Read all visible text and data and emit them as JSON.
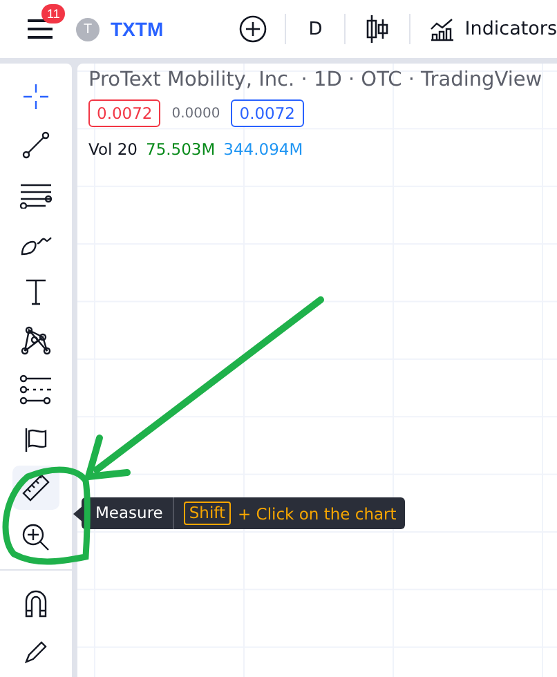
{
  "header": {
    "notification_count": "11",
    "symbol_initial": "T",
    "symbol": "TXTM",
    "interval": "D",
    "indicators_label": "Indicators"
  },
  "legend": {
    "title": "ProText Mobility, Inc. · 1D · OTC · TradingView",
    "sell_price": "0.0072",
    "spread": "0.0000",
    "buy_price": "0.0072",
    "volume_label": "Vol 20",
    "volume": "75.503M",
    "volume_ma": "344.094M"
  },
  "tools": [
    {
      "kind": "crosshair",
      "selected": true
    },
    {
      "kind": "trendline",
      "selected": false
    },
    {
      "kind": "channel",
      "selected": false
    },
    {
      "kind": "brush",
      "selected": false
    },
    {
      "kind": "text",
      "selected": false
    },
    {
      "kind": "pattern",
      "selected": false
    },
    {
      "kind": "fib",
      "selected": false
    },
    {
      "kind": "flag",
      "selected": false
    },
    {
      "kind": "ruler",
      "selected": false,
      "hovered": true
    },
    {
      "kind": "zoom",
      "selected": false
    },
    {
      "kind": "divider"
    },
    {
      "kind": "magnet",
      "selected": false
    },
    {
      "kind": "pencil",
      "selected": false
    }
  ],
  "tooltip": {
    "label": "Measure",
    "hotkey": "Shift",
    "hint": "+ Click on the chart"
  }
}
